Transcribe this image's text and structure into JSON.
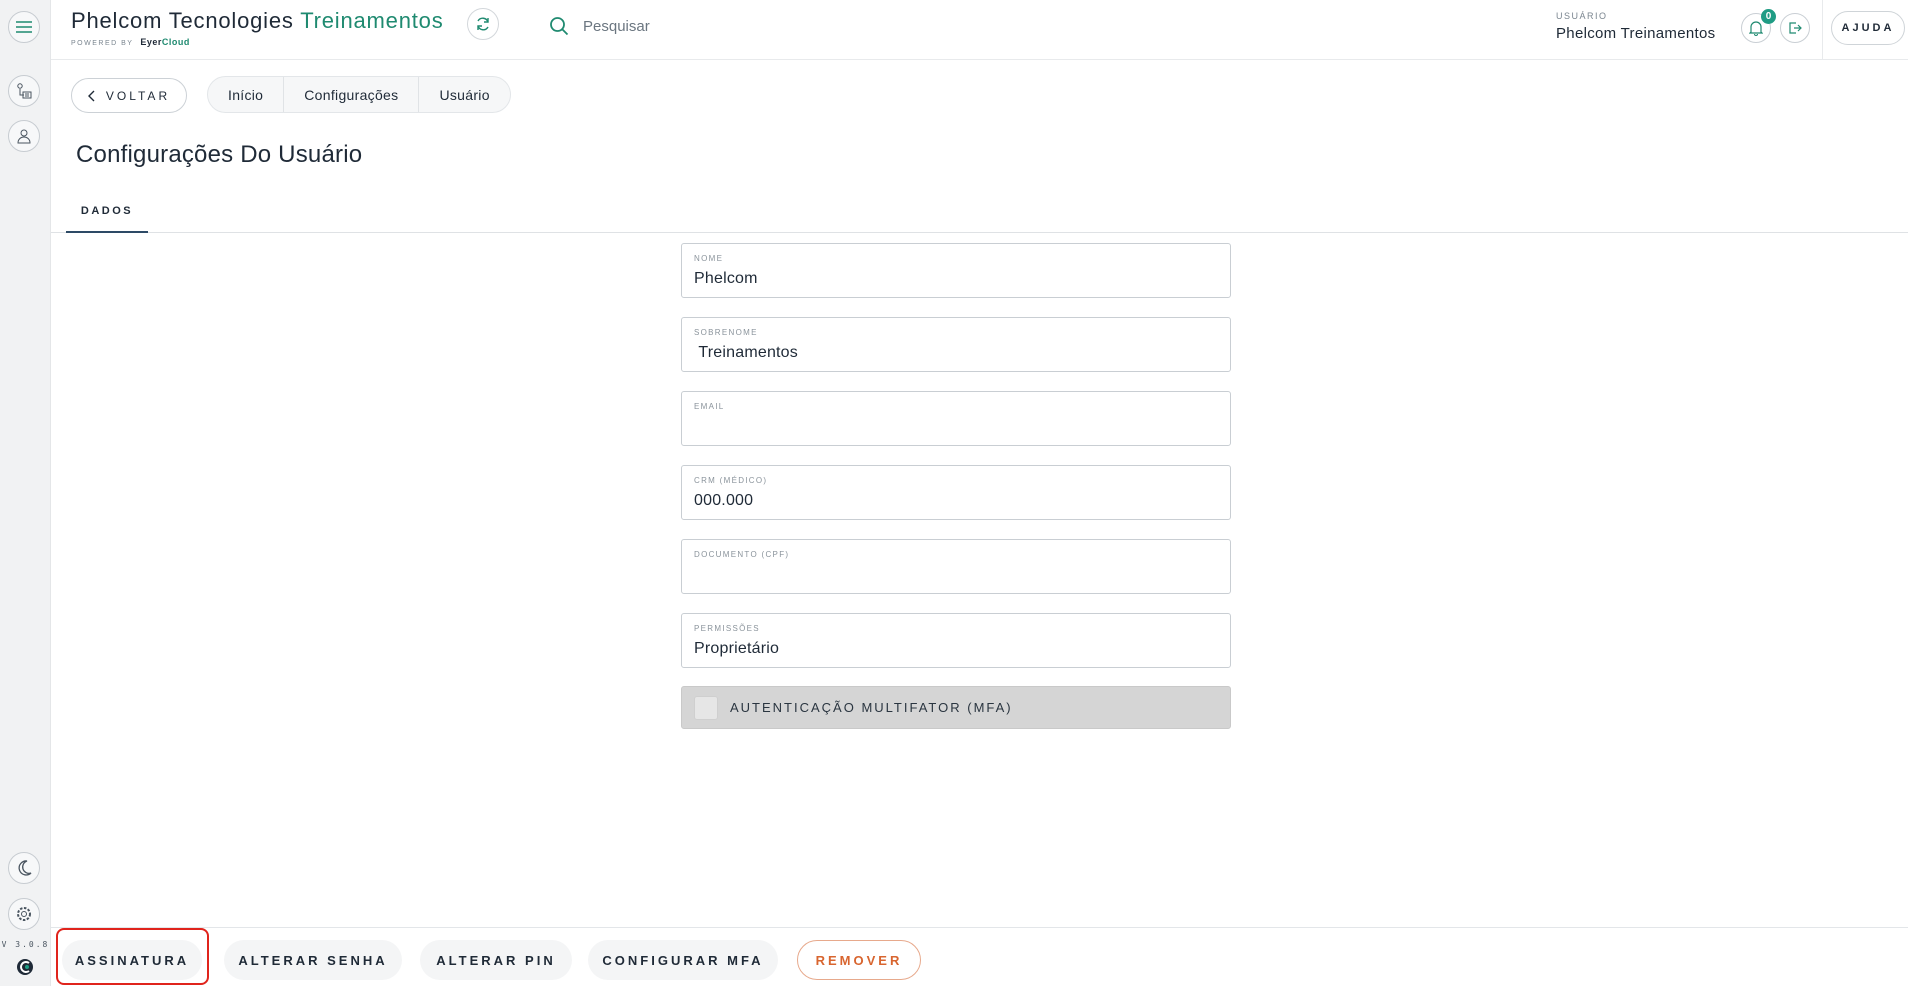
{
  "rail": {
    "version": "V 3.0.8"
  },
  "header": {
    "brand_main": "Phelcom Tecnologies",
    "brand_accent": "Treinamentos",
    "powered_by": "POWERED BY",
    "powered_brand": "Eyer",
    "powered_brand_accent": "Cloud",
    "search_placeholder": "Pesquisar",
    "user_label": "USUÁRIO",
    "user_name": "Phelcom Treinamentos",
    "notification_count": "0",
    "help_label": "AJUDA"
  },
  "nav": {
    "back_label": "VOLTAR",
    "breadcrumb": [
      "Início",
      "Configurações",
      "Usuário"
    ]
  },
  "page": {
    "title": "Configurações Do Usuário",
    "tab": "DADOS"
  },
  "form": {
    "fields": [
      {
        "label": "NOME",
        "value": "Phelcom"
      },
      {
        "label": "SOBRENOME",
        "value": " Treinamentos"
      },
      {
        "label": "EMAIL",
        "value": ""
      },
      {
        "label": "CRM (MÉDICO)",
        "value": "000.000"
      },
      {
        "label": "DOCUMENTO (CPF)",
        "value": ""
      },
      {
        "label": "PERMISSÕES",
        "value": "Proprietário"
      }
    ],
    "mfa_label": "AUTENTICAÇÃO MULTIFATOR (MFA)"
  },
  "actions": {
    "signature": "ASSINATURA",
    "change_password": "ALTERAR SENHA",
    "change_pin": "ALTERAR PIN",
    "configure_mfa": "CONFIGURAR MFA",
    "remove": "REMOVER"
  },
  "colors": {
    "accent": "#1f8a70",
    "remove": "#d8652f",
    "highlight": "#e0241c",
    "mfa_bg": "#d5d5d5"
  }
}
